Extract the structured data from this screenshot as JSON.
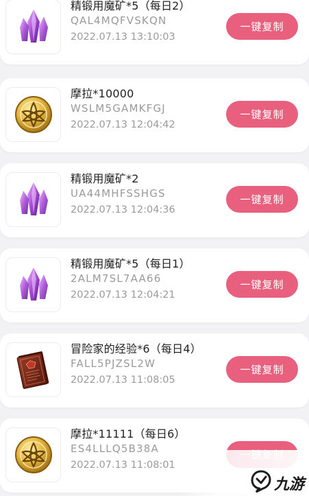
{
  "items": [
    {
      "icon": "purple-crystal-icon",
      "title": "精锻用魔矿*5（每日2）",
      "code": "QAL4MQFVSKQN",
      "time": "2022.07.13 13:10:03",
      "button": "一键复制"
    },
    {
      "icon": "gold-coin-icon",
      "title": "摩拉*10000",
      "code": "WSLM5GAMKFGJ",
      "time": "2022.07.13 12:04:42",
      "button": "一键复制"
    },
    {
      "icon": "purple-crystal-icon",
      "title": "精锻用魔矿*2",
      "code": "UA44MHFSSHGS",
      "time": "2022.07.13 12:04:36",
      "button": "一键复制"
    },
    {
      "icon": "purple-crystal-icon",
      "title": "精锻用魔矿*5（每日1）",
      "code": "2ALM7SL7AA66",
      "time": "2022.07.13 12:04:21",
      "button": "一键复制"
    },
    {
      "icon": "red-book-icon",
      "title": "冒险家的经验*6（每日4）",
      "code": "FALL5PJZSL2W",
      "time": "2022.07.13 11:08:05",
      "button": "一键复制"
    },
    {
      "icon": "gold-coin-icon",
      "title": "摩拉*11111（每日6）",
      "code": "ES4LLLQ5B38A",
      "time": "2022.07.13 11:08:01",
      "button": "一键复制"
    }
  ],
  "watermark": {
    "text": "九游",
    "icon": "jiuyou-logo-icon"
  },
  "colors": {
    "button": "#e9607f",
    "background": "#f2f2f4",
    "card": "#ffffff",
    "crystal": "#9b3fc8",
    "coin": "#d9a521",
    "book": "#7a2418"
  }
}
